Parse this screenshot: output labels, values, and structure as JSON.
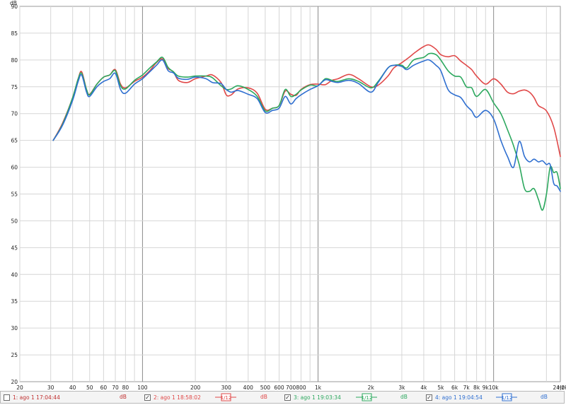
{
  "chart_data": {
    "type": "line",
    "xscale": "log",
    "xlim": [
      20,
      24000
    ],
    "ylim": [
      20,
      90
    ],
    "grid": true,
    "y_unit": "dB",
    "x_unit": "Hz",
    "y_ticks": [
      20,
      25,
      30,
      35,
      40,
      45,
      50,
      55,
      60,
      65,
      70,
      75,
      80,
      85,
      90
    ],
    "x_ticks": [
      {
        "v": 20,
        "l": "20"
      },
      {
        "v": 30,
        "l": "30"
      },
      {
        "v": 40,
        "l": "40"
      },
      {
        "v": 50,
        "l": "50"
      },
      {
        "v": 60,
        "l": "60"
      },
      {
        "v": 70,
        "l": "70"
      },
      {
        "v": 80,
        "l": "80"
      },
      {
        "v": 100,
        "l": "100"
      },
      {
        "v": 200,
        "l": "200"
      },
      {
        "v": 300,
        "l": "300"
      },
      {
        "v": 400,
        "l": "400"
      },
      {
        "v": 500,
        "l": "500"
      },
      {
        "v": 600,
        "l": "600"
      },
      {
        "v": 700,
        "l": "700"
      },
      {
        "v": 800,
        "l": "800"
      },
      {
        "v": 1000,
        "l": "1k"
      },
      {
        "v": 2000,
        "l": "2k"
      },
      {
        "v": 3000,
        "l": "3k"
      },
      {
        "v": 4000,
        "l": "4k"
      },
      {
        "v": 5000,
        "l": "5k"
      },
      {
        "v": 6000,
        "l": "6k"
      },
      {
        "v": 7000,
        "l": "7k"
      },
      {
        "v": 8000,
        "l": "8k"
      },
      {
        "v": 9000,
        "l": "9k"
      },
      {
        "v": 10000,
        "l": "10k"
      },
      {
        "v": 24000,
        "l": "24,0k"
      }
    ],
    "series": [
      {
        "name": "2: ago 1 18:58:02",
        "color": "#e04848",
        "points": [
          [
            31,
            65
          ],
          [
            35,
            68.2
          ],
          [
            40,
            73
          ],
          [
            43,
            76.5
          ],
          [
            45,
            77.8
          ],
          [
            48,
            74.5
          ],
          [
            50,
            73.6
          ],
          [
            55,
            75.5
          ],
          [
            60,
            76.8
          ],
          [
            65,
            77.2
          ],
          [
            70,
            78.2
          ],
          [
            75,
            75.5
          ],
          [
            80,
            74.8
          ],
          [
            90,
            76
          ],
          [
            100,
            76.8
          ],
          [
            110,
            78
          ],
          [
            120,
            79.5
          ],
          [
            130,
            80.2
          ],
          [
            140,
            78.4
          ],
          [
            150,
            77.8
          ],
          [
            160,
            76.2
          ],
          [
            180,
            75.8
          ],
          [
            200,
            76.5
          ],
          [
            230,
            77
          ],
          [
            250,
            77.2
          ],
          [
            280,
            75.8
          ],
          [
            300,
            73.5
          ],
          [
            320,
            73.5
          ],
          [
            350,
            74.6
          ],
          [
            400,
            74.8
          ],
          [
            450,
            73.8
          ],
          [
            500,
            70.8
          ],
          [
            550,
            71
          ],
          [
            600,
            71.5
          ],
          [
            650,
            74.2
          ],
          [
            700,
            73.6
          ],
          [
            750,
            73.4
          ],
          [
            800,
            74.5
          ],
          [
            900,
            75.4
          ],
          [
            1000,
            75.5
          ],
          [
            1100,
            75.4
          ],
          [
            1200,
            76.2
          ],
          [
            1300,
            76.5
          ],
          [
            1500,
            77.3
          ],
          [
            1700,
            76.5
          ],
          [
            2000,
            75
          ],
          [
            2200,
            75.3
          ],
          [
            2500,
            77
          ],
          [
            2700,
            78.5
          ],
          [
            3000,
            79.5
          ],
          [
            3300,
            80.5
          ],
          [
            3600,
            81.5
          ],
          [
            4000,
            82.5
          ],
          [
            4300,
            82.8
          ],
          [
            4700,
            82
          ],
          [
            5000,
            81
          ],
          [
            5500,
            80.6
          ],
          [
            6000,
            80.8
          ],
          [
            6500,
            79.8
          ],
          [
            7000,
            79
          ],
          [
            7500,
            78.2
          ],
          [
            8000,
            77
          ],
          [
            9000,
            75.5
          ],
          [
            10000,
            76.5
          ],
          [
            11000,
            75.5
          ],
          [
            12000,
            74
          ],
          [
            13000,
            73.7
          ],
          [
            14000,
            74.2
          ],
          [
            15000,
            74.4
          ],
          [
            16000,
            74
          ],
          [
            17000,
            73
          ],
          [
            18000,
            71.5
          ],
          [
            20000,
            70.5
          ],
          [
            22000,
            67.5
          ],
          [
            24000,
            62
          ]
        ]
      },
      {
        "name": "3: ago 1 19:03:34",
        "color": "#2ca85e",
        "points": [
          [
            31,
            65
          ],
          [
            35,
            68
          ],
          [
            40,
            73
          ],
          [
            43,
            76.5
          ],
          [
            45,
            77.5
          ],
          [
            48,
            74.5
          ],
          [
            50,
            73.5
          ],
          [
            55,
            75.5
          ],
          [
            60,
            76.8
          ],
          [
            65,
            77.2
          ],
          [
            70,
            78
          ],
          [
            75,
            75.2
          ],
          [
            80,
            74.6
          ],
          [
            90,
            76.2
          ],
          [
            100,
            77.2
          ],
          [
            110,
            78.5
          ],
          [
            120,
            79.6
          ],
          [
            130,
            80.5
          ],
          [
            140,
            78.6
          ],
          [
            150,
            77.8
          ],
          [
            160,
            77
          ],
          [
            180,
            76.8
          ],
          [
            200,
            77
          ],
          [
            230,
            77
          ],
          [
            250,
            76.7
          ],
          [
            280,
            75.2
          ],
          [
            300,
            74.5
          ],
          [
            320,
            74.6
          ],
          [
            350,
            75.2
          ],
          [
            400,
            74.5
          ],
          [
            450,
            73.2
          ],
          [
            500,
            70.5
          ],
          [
            550,
            71
          ],
          [
            600,
            71.5
          ],
          [
            650,
            74.5
          ],
          [
            700,
            73.2
          ],
          [
            750,
            73.6
          ],
          [
            800,
            74.4
          ],
          [
            900,
            75.3
          ],
          [
            1000,
            75.2
          ],
          [
            1100,
            76.5
          ],
          [
            1200,
            76.2
          ],
          [
            1300,
            76
          ],
          [
            1500,
            76.5
          ],
          [
            1700,
            76
          ],
          [
            2000,
            74.8
          ],
          [
            2200,
            76
          ],
          [
            2500,
            78.5
          ],
          [
            2700,
            79
          ],
          [
            3000,
            79
          ],
          [
            3200,
            78.5
          ],
          [
            3500,
            80
          ],
          [
            4000,
            80.5
          ],
          [
            4300,
            81.2
          ],
          [
            4700,
            81
          ],
          [
            5000,
            80
          ],
          [
            5500,
            78
          ],
          [
            6000,
            77
          ],
          [
            6500,
            76.8
          ],
          [
            7000,
            75
          ],
          [
            7500,
            74.8
          ],
          [
            8000,
            73.2
          ],
          [
            9000,
            74.5
          ],
          [
            10000,
            72
          ],
          [
            11000,
            70
          ],
          [
            12000,
            67
          ],
          [
            13000,
            64
          ],
          [
            14000,
            60.5
          ],
          [
            15000,
            56
          ],
          [
            16000,
            55.5
          ],
          [
            17000,
            56
          ],
          [
            18000,
            54
          ],
          [
            19000,
            52
          ],
          [
            20000,
            55
          ],
          [
            21000,
            60
          ],
          [
            22000,
            59
          ],
          [
            23000,
            59
          ],
          [
            24000,
            56
          ]
        ]
      },
      {
        "name": "4: ago 1 19:04:54",
        "color": "#2f6fd0",
        "points": [
          [
            31,
            65
          ],
          [
            35,
            67.8
          ],
          [
            40,
            72.5
          ],
          [
            43,
            76
          ],
          [
            45,
            77.2
          ],
          [
            48,
            74
          ],
          [
            50,
            73.2
          ],
          [
            55,
            75
          ],
          [
            60,
            76
          ],
          [
            65,
            76.5
          ],
          [
            70,
            77.5
          ],
          [
            75,
            74.5
          ],
          [
            80,
            73.8
          ],
          [
            90,
            75.5
          ],
          [
            100,
            76.5
          ],
          [
            110,
            77.8
          ],
          [
            120,
            79
          ],
          [
            130,
            80
          ],
          [
            140,
            78
          ],
          [
            150,
            77.6
          ],
          [
            160,
            76.6
          ],
          [
            180,
            76.4
          ],
          [
            200,
            76.8
          ],
          [
            230,
            76.5
          ],
          [
            250,
            75.8
          ],
          [
            280,
            75.6
          ],
          [
            300,
            74.5
          ],
          [
            320,
            74
          ],
          [
            350,
            74.3
          ],
          [
            400,
            73.6
          ],
          [
            450,
            72.8
          ],
          [
            500,
            70.2
          ],
          [
            550,
            70.6
          ],
          [
            600,
            71
          ],
          [
            650,
            73.2
          ],
          [
            700,
            71.8
          ],
          [
            750,
            72.8
          ],
          [
            800,
            73.5
          ],
          [
            900,
            74.5
          ],
          [
            1000,
            75.2
          ],
          [
            1100,
            76.3
          ],
          [
            1200,
            76
          ],
          [
            1300,
            75.8
          ],
          [
            1500,
            76.2
          ],
          [
            1700,
            75.6
          ],
          [
            2000,
            74
          ],
          [
            2200,
            75.8
          ],
          [
            2500,
            78.5
          ],
          [
            2700,
            79
          ],
          [
            3000,
            78.8
          ],
          [
            3200,
            78.2
          ],
          [
            3500,
            79
          ],
          [
            4000,
            79.8
          ],
          [
            4300,
            80
          ],
          [
            4700,
            79
          ],
          [
            5000,
            78
          ],
          [
            5500,
            74.5
          ],
          [
            6000,
            73.5
          ],
          [
            6500,
            73
          ],
          [
            7000,
            71.5
          ],
          [
            7500,
            70.5
          ],
          [
            8000,
            69.3
          ],
          [
            9000,
            70.6
          ],
          [
            10000,
            69
          ],
          [
            11000,
            65
          ],
          [
            12000,
            62
          ],
          [
            13000,
            60
          ],
          [
            14000,
            64.8
          ],
          [
            15000,
            62
          ],
          [
            16000,
            61
          ],
          [
            17000,
            61.5
          ],
          [
            18000,
            61
          ],
          [
            19000,
            61.2
          ],
          [
            20000,
            60.5
          ],
          [
            21000,
            60.5
          ],
          [
            22000,
            57
          ],
          [
            23000,
            56.5
          ],
          [
            24000,
            55.5
          ]
        ]
      }
    ]
  },
  "legend": {
    "items": [
      {
        "label": "1: ago 1 17:04:44",
        "checked": false,
        "color": "#c03030"
      },
      {
        "label": "2: ago 1 18:58:02",
        "checked": true,
        "color": "#e04848"
      },
      {
        "label": "3: ago 1 19:03:34",
        "checked": true,
        "color": "#2ca85e"
      },
      {
        "label": "4: ago 1 19:04:54",
        "checked": true,
        "color": "#2f6fd0"
      }
    ],
    "unit_labels": [
      {
        "text": "dB",
        "color": "#c03030"
      },
      {
        "text": "dB",
        "color": "#e04848"
      },
      {
        "text": "dB",
        "color": "#2ca85e"
      },
      {
        "text": "dB",
        "color": "#2f6fd0"
      }
    ],
    "smoothing_label": "1/12",
    "check_mark": "✓"
  }
}
